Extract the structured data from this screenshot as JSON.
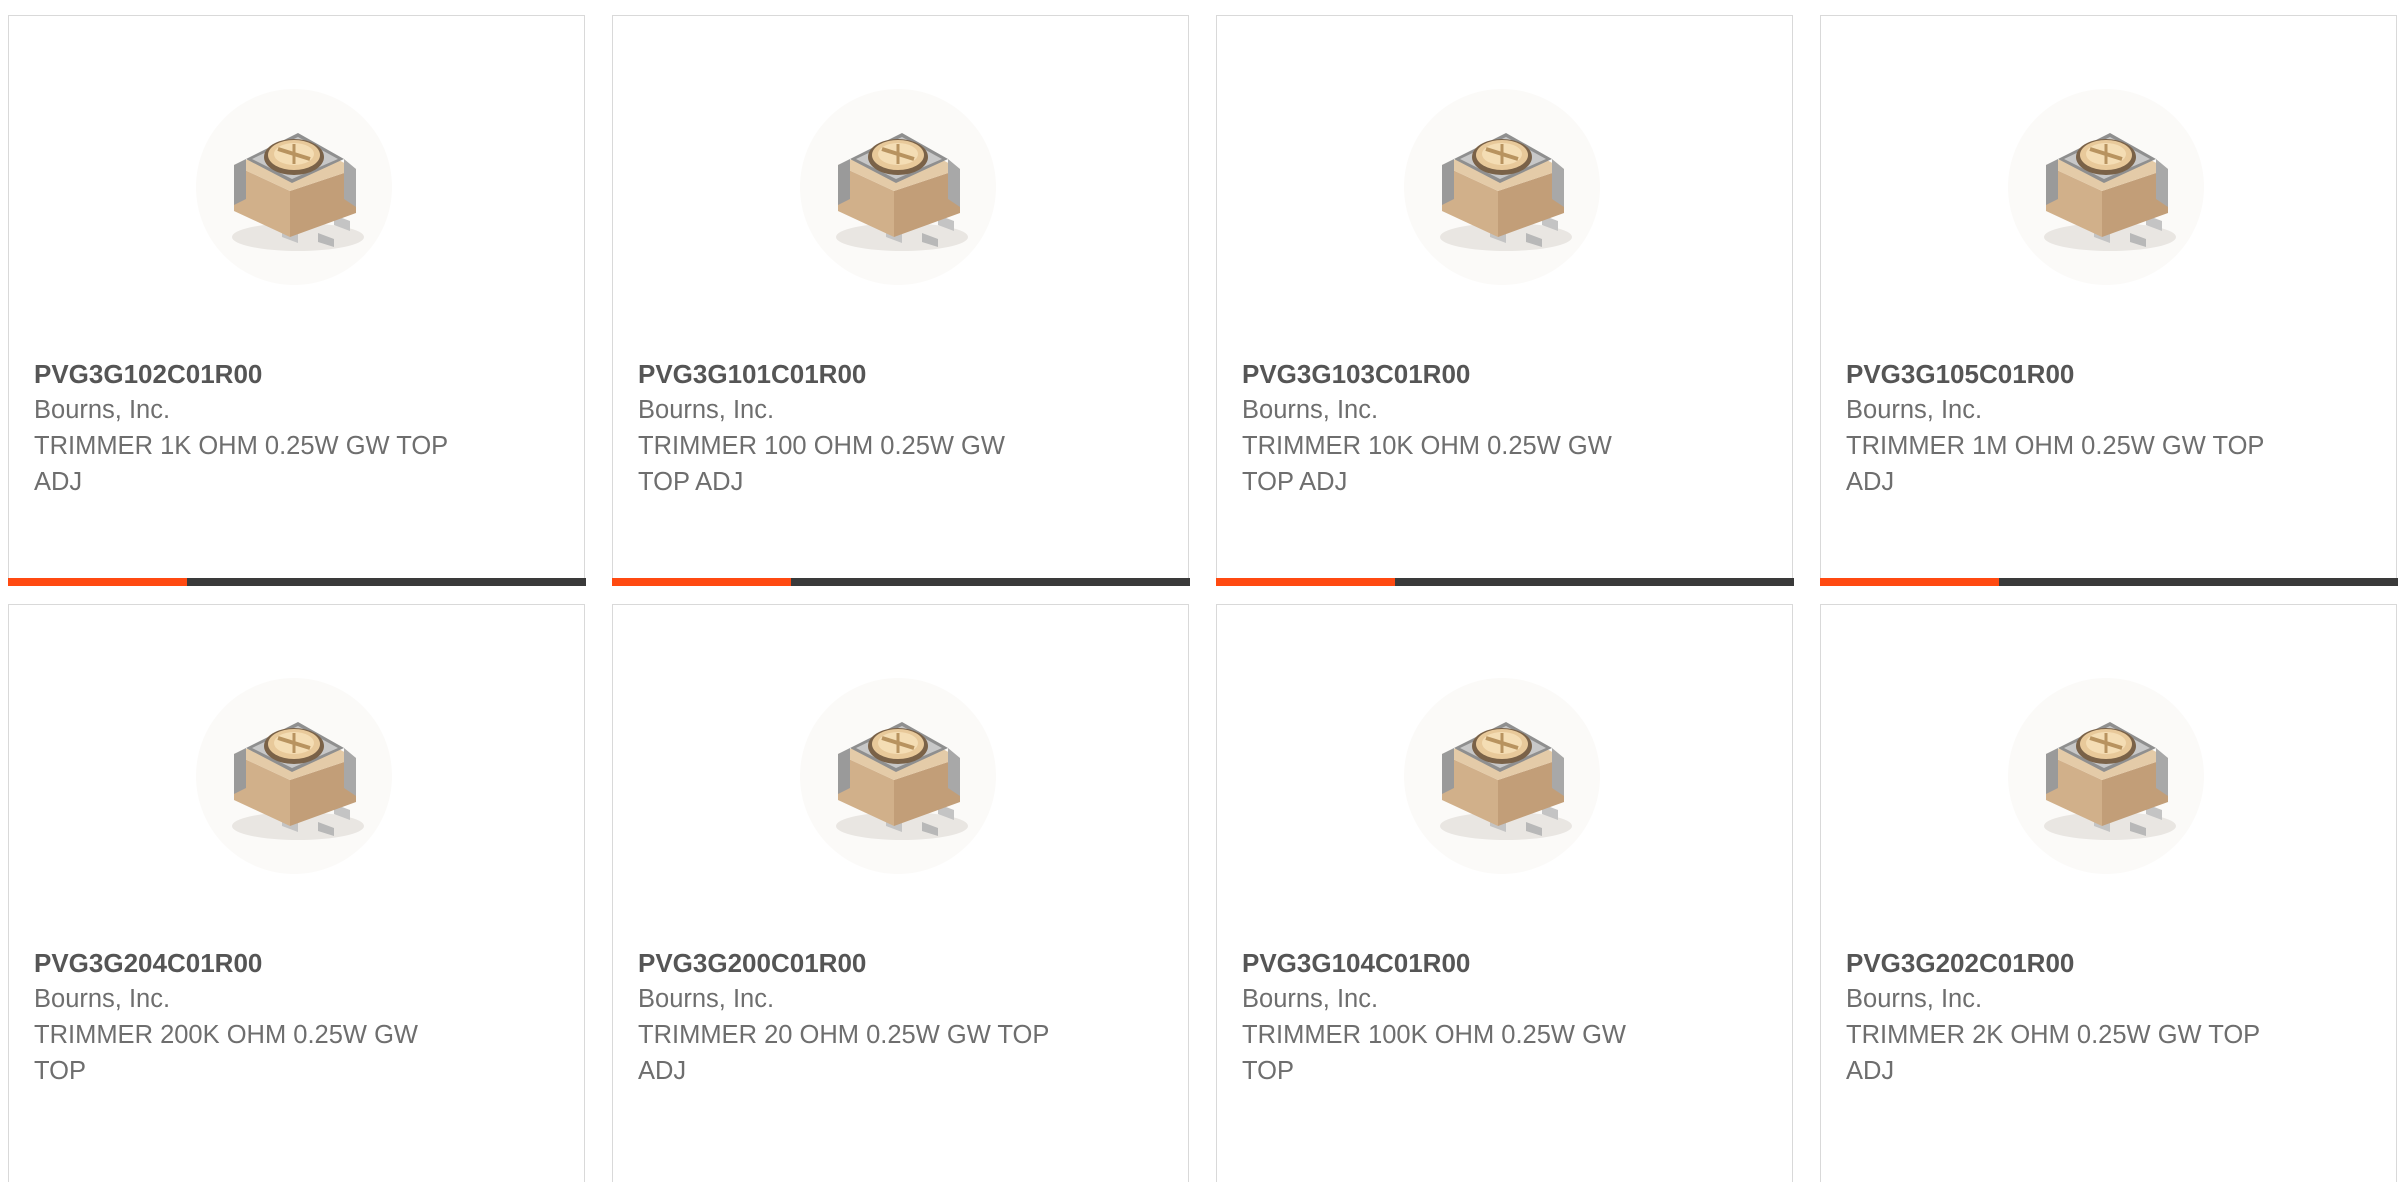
{
  "colors": {
    "accent": "#ff4a11",
    "track": "#3a3a3a",
    "card_border": "#d9d9d9",
    "part_number_text": "#555555",
    "secondary_text": "#6e6e6e"
  },
  "products": [
    {
      "part_number": "PVG3G102C01R00",
      "manufacturer": "Bourns, Inc.",
      "description": "TRIMMER 1K OHM 0.25W GW TOP ADJ",
      "image_icon": "trimmer-potentiometer-icon",
      "progress": 0.31
    },
    {
      "part_number": "PVG3G101C01R00",
      "manufacturer": "Bourns, Inc.",
      "description": "TRIMMER 100 OHM 0.25W GW TOP ADJ",
      "image_icon": "trimmer-potentiometer-icon",
      "progress": 0.31
    },
    {
      "part_number": "PVG3G103C01R00",
      "manufacturer": "Bourns, Inc.",
      "description": "TRIMMER 10K OHM 0.25W GW TOP ADJ",
      "image_icon": "trimmer-potentiometer-icon",
      "progress": 0.31
    },
    {
      "part_number": "PVG3G105C01R00",
      "manufacturer": "Bourns, Inc.",
      "description": "TRIMMER 1M OHM 0.25W GW TOP ADJ",
      "image_icon": "trimmer-potentiometer-icon",
      "progress": 0.31
    },
    {
      "part_number": "PVG3G204C01R00",
      "manufacturer": "Bourns, Inc.",
      "description": "TRIMMER 200K OHM 0.25W GW TOP",
      "image_icon": "trimmer-potentiometer-icon"
    },
    {
      "part_number": "PVG3G200C01R00",
      "manufacturer": "Bourns, Inc.",
      "description": "TRIMMER 20 OHM 0.25W GW TOP ADJ",
      "image_icon": "trimmer-potentiometer-icon"
    },
    {
      "part_number": "PVG3G104C01R00",
      "manufacturer": "Bourns, Inc.",
      "description": "TRIMMER 100K OHM 0.25W GW TOP",
      "image_icon": "trimmer-potentiometer-icon"
    },
    {
      "part_number": "PVG3G202C01R00",
      "manufacturer": "Bourns, Inc.",
      "description": "TRIMMER 2K OHM 0.25W GW TOP ADJ",
      "image_icon": "trimmer-potentiometer-icon"
    }
  ]
}
